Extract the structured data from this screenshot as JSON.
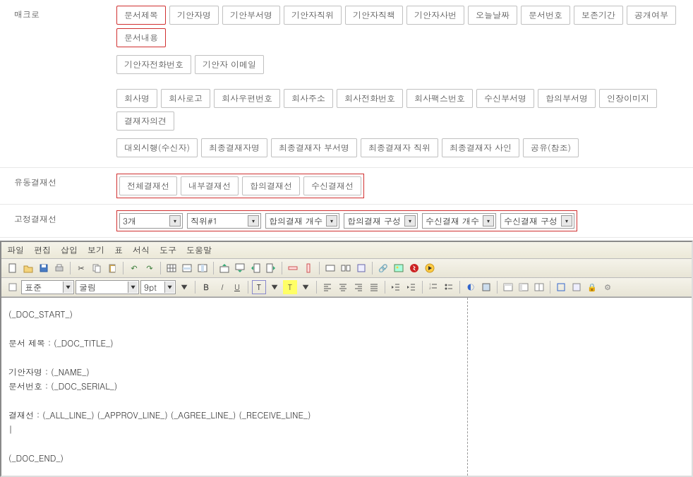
{
  "sections": {
    "macro": {
      "label": "매크로",
      "row1": [
        "문서제목",
        "기안자명",
        "기안부서명",
        "기안자직위",
        "기안자직책",
        "기안자사번",
        "오늘날짜",
        "문서번호",
        "보존기간",
        "공개여부",
        "문서내용"
      ],
      "row1_highlighted": [
        0,
        10
      ],
      "row2": [
        "기안자전화번호",
        "기안자 이메일"
      ],
      "row3": [
        "회사명",
        "회사로고",
        "회사우편번호",
        "회사주소",
        "회사전화번호",
        "회사팩스번호",
        "수신부서명",
        "합의부서명",
        "인장이미지",
        "결재자의견"
      ],
      "row4": [
        "대외시행(수신자)",
        "최종결재자명",
        "최종결재자 부서명",
        "최종결재자 직위",
        "최종결재자 사인",
        "공유(참조)"
      ]
    },
    "flowline": {
      "label": "유동결재선",
      "items": [
        "전체결재선",
        "내부결재선",
        "합의결재선",
        "수신결재선"
      ]
    },
    "fixedline": {
      "label": "고정결재선",
      "selects": [
        {
          "value": "3개",
          "width": "wide"
        },
        {
          "value": "직위#1",
          "width": "med"
        },
        {
          "value": "합의결재 개수",
          "width": "med"
        },
        {
          "value": "합의결재 구성",
          "width": "med"
        },
        {
          "value": "수신결재 개수",
          "width": "med"
        },
        {
          "value": "수신결재 구성",
          "width": "med"
        }
      ]
    }
  },
  "editor": {
    "menus": [
      "파일",
      "편집",
      "삽입",
      "보기",
      "표",
      "서식",
      "도구",
      "도움말"
    ],
    "style_select": "표준",
    "font_select": "굴림",
    "size_select": "9pt",
    "body_lines": [
      "(_DOC_START_)",
      "",
      "문서 제목 : (_DOC_TITLE_)",
      "",
      "기안자명 : (_NAME_)",
      "문서번호 : (_DOC_SERIAL_)",
      "",
      "결재선 : (_ALL_LINE_) (_APPROV_LINE_) (_AGREE_LINE_) (_RECEIVE_LINE_)",
      "|",
      "",
      "(_DOC_END_)"
    ]
  }
}
